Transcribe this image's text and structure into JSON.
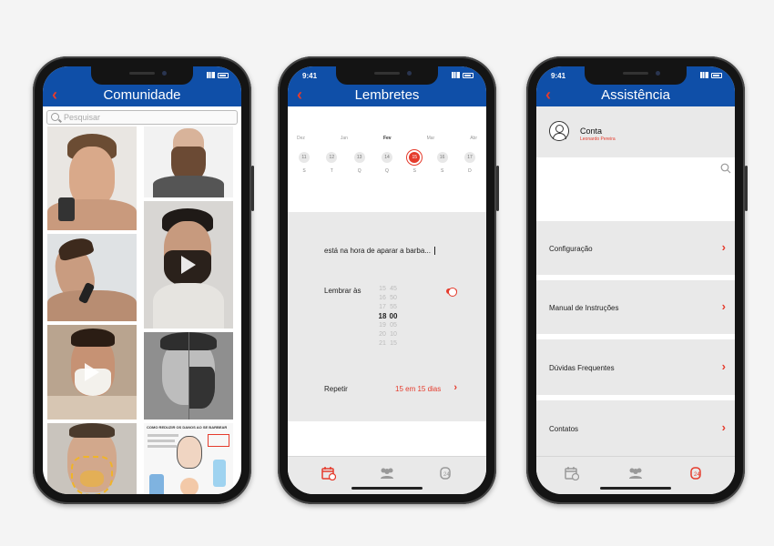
{
  "status": {
    "time": "9:41"
  },
  "screen1": {
    "title": "Comunidade",
    "search_placeholder": "Pesquisar",
    "article_title": "COMO REDUZIR OS DANOS AO SE BARBEAR"
  },
  "screen2": {
    "title": "Lembretes",
    "months": [
      "Dez",
      "Jan",
      "Fev",
      "Mar",
      "Abr"
    ],
    "active_month": "Fev",
    "days": [
      "11",
      "12",
      "13",
      "14",
      "15",
      "16",
      "17"
    ],
    "selected_day": "15",
    "weekdays": [
      "S",
      "T",
      "Q",
      "Q",
      "S",
      "S",
      "D"
    ],
    "message": "está na hora de aparar a barba...",
    "remind_label": "Lembrar às",
    "hours": [
      "15",
      "16",
      "17",
      "18",
      "19",
      "20",
      "21"
    ],
    "minutes": [
      "45",
      "50",
      "55",
      "00",
      "05",
      "10",
      "15"
    ],
    "selected_hour": "18",
    "selected_minute": "00",
    "toggle_on": true,
    "repeat_label": "Repetir",
    "repeat_value": "15 em 15 dias"
  },
  "screen3": {
    "title": "Assistência",
    "account_name": "Conta",
    "account_sub": "Leonardo Pereira",
    "menu": [
      {
        "label": "Configuração"
      },
      {
        "label": "Manual de Instruções"
      },
      {
        "label": "Dúvidas Frequentes"
      },
      {
        "label": "Contatos"
      }
    ]
  },
  "colors": {
    "brand_blue": "#0f4fa8",
    "accent_red": "#e53b2c"
  },
  "icons": [
    "back-chevron-icon",
    "search-icon",
    "play-icon",
    "calendar-icon",
    "community-icon",
    "support-icon",
    "chevron-right-icon",
    "user-icon"
  ]
}
